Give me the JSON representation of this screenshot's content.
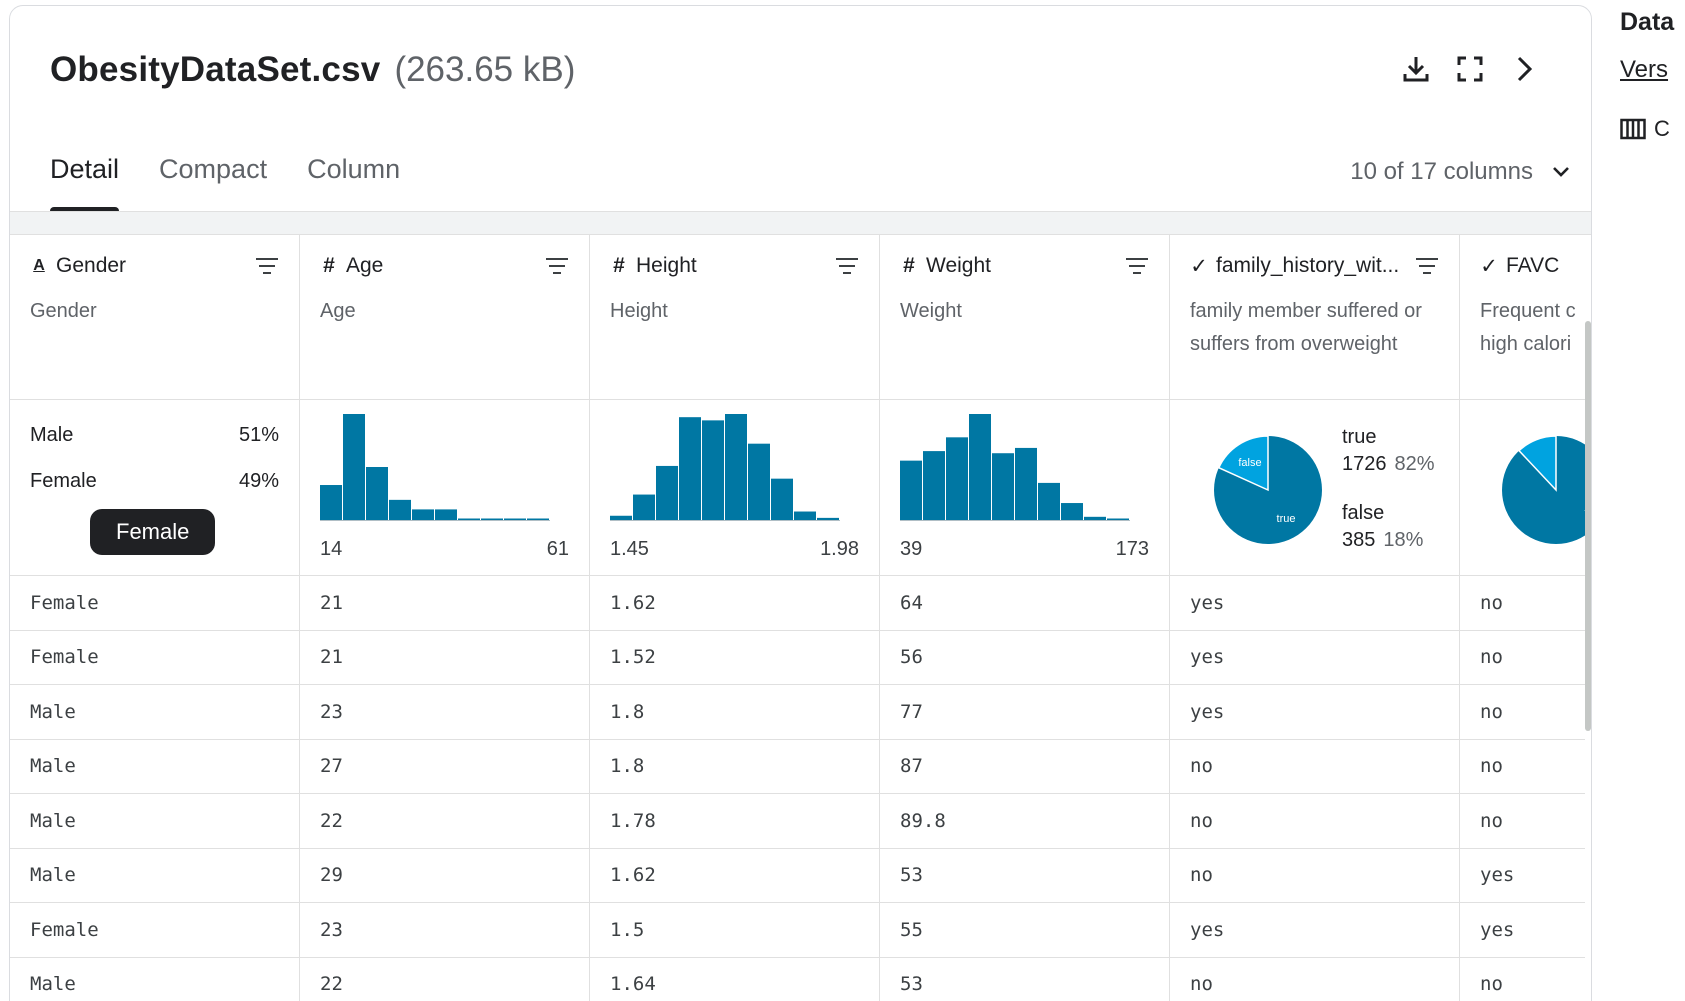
{
  "file": {
    "name": "ObesityDataSet.csv",
    "size": "(263.65 kB)"
  },
  "header_icons": [
    "download-icon",
    "fullscreen-icon",
    "chevron-right-icon"
  ],
  "tabs": [
    {
      "label": "Detail",
      "active": true
    },
    {
      "label": "Compact",
      "active": false
    },
    {
      "label": "Column",
      "active": false
    }
  ],
  "column_selector": {
    "label": "10 of 17 columns"
  },
  "sidebar": {
    "title": "Data",
    "link": "Vers",
    "columns_label": "C"
  },
  "colors": {
    "bar": "#0077a3",
    "pie_main": "#0077a3",
    "pie_minor": "#00a3e0",
    "tooltip_bg": "#202124"
  },
  "columns": [
    {
      "name": "Gender",
      "type_icon": "A",
      "description": "Gender"
    },
    {
      "name": "Age",
      "type_icon": "#",
      "description": "Age"
    },
    {
      "name": "Height",
      "type_icon": "#",
      "description": "Height"
    },
    {
      "name": "Weight",
      "type_icon": "#",
      "description": "Weight"
    },
    {
      "name": "family_history_wit...",
      "type_icon": "✓",
      "description": "family member suffered or\nsuffers from overweight"
    },
    {
      "name": "FAVC",
      "type_icon": "✓",
      "description": "Frequent c\nhigh calori"
    }
  ],
  "summaries": {
    "gender": {
      "categories": [
        {
          "label": "Male",
          "pct": "51%"
        },
        {
          "label": "Female",
          "pct": "49%"
        }
      ],
      "tooltip": "Female"
    },
    "age_hist": {
      "min": "14",
      "max": "61"
    },
    "height_hist": {
      "min": "1.45",
      "max": "1.98"
    },
    "weight_hist": {
      "min": "39",
      "max": "173"
    },
    "family_pie": {
      "true_label": "true",
      "true_count": "1726",
      "true_pct": "82%",
      "false_label": "false",
      "false_count": "385",
      "false_pct": "18%",
      "slice_true": "true",
      "slice_false": "false"
    },
    "favc_pie": {
      "slice_true": "true"
    }
  },
  "chart_data": [
    {
      "type": "bar",
      "title": "",
      "x_range": [
        14,
        61
      ],
      "values": [
        0.33,
        1.0,
        0.5,
        0.19,
        0.1,
        0.1,
        0.01,
        0.01,
        0.01,
        0.01
      ]
    },
    {
      "type": "bar",
      "title": "",
      "x_range": [
        1.45,
        1.98
      ],
      "values": [
        0.04,
        0.24,
        0.51,
        0.97,
        0.94,
        1.0,
        0.72,
        0.39,
        0.08,
        0.02
      ]
    },
    {
      "type": "bar",
      "title": "",
      "x_range": [
        39,
        173
      ],
      "values": [
        0.56,
        0.65,
        0.78,
        1.0,
        0.63,
        0.68,
        0.35,
        0.16,
        0.03,
        0.01
      ]
    },
    {
      "type": "pie",
      "title": "",
      "slices": [
        {
          "label": "true",
          "value": 1726,
          "pct": 82
        },
        {
          "label": "false",
          "value": 385,
          "pct": 18
        }
      ]
    },
    {
      "type": "pie",
      "title": "",
      "slices": [
        {
          "label": "true",
          "value": 88
        },
        {
          "label": "false",
          "value": 12
        }
      ]
    }
  ],
  "rows": [
    [
      "Female",
      "21",
      "1.62",
      "64",
      "yes",
      "no"
    ],
    [
      "Female",
      "21",
      "1.52",
      "56",
      "yes",
      "no"
    ],
    [
      "Male",
      "23",
      "1.8",
      "77",
      "yes",
      "no"
    ],
    [
      "Male",
      "27",
      "1.8",
      "87",
      "no",
      "no"
    ],
    [
      "Male",
      "22",
      "1.78",
      "89.8",
      "no",
      "no"
    ],
    [
      "Male",
      "29",
      "1.62",
      "53",
      "no",
      "yes"
    ],
    [
      "Female",
      "23",
      "1.5",
      "55",
      "yes",
      "yes"
    ],
    [
      "Male",
      "22",
      "1.64",
      "53",
      "no",
      "no"
    ]
  ]
}
